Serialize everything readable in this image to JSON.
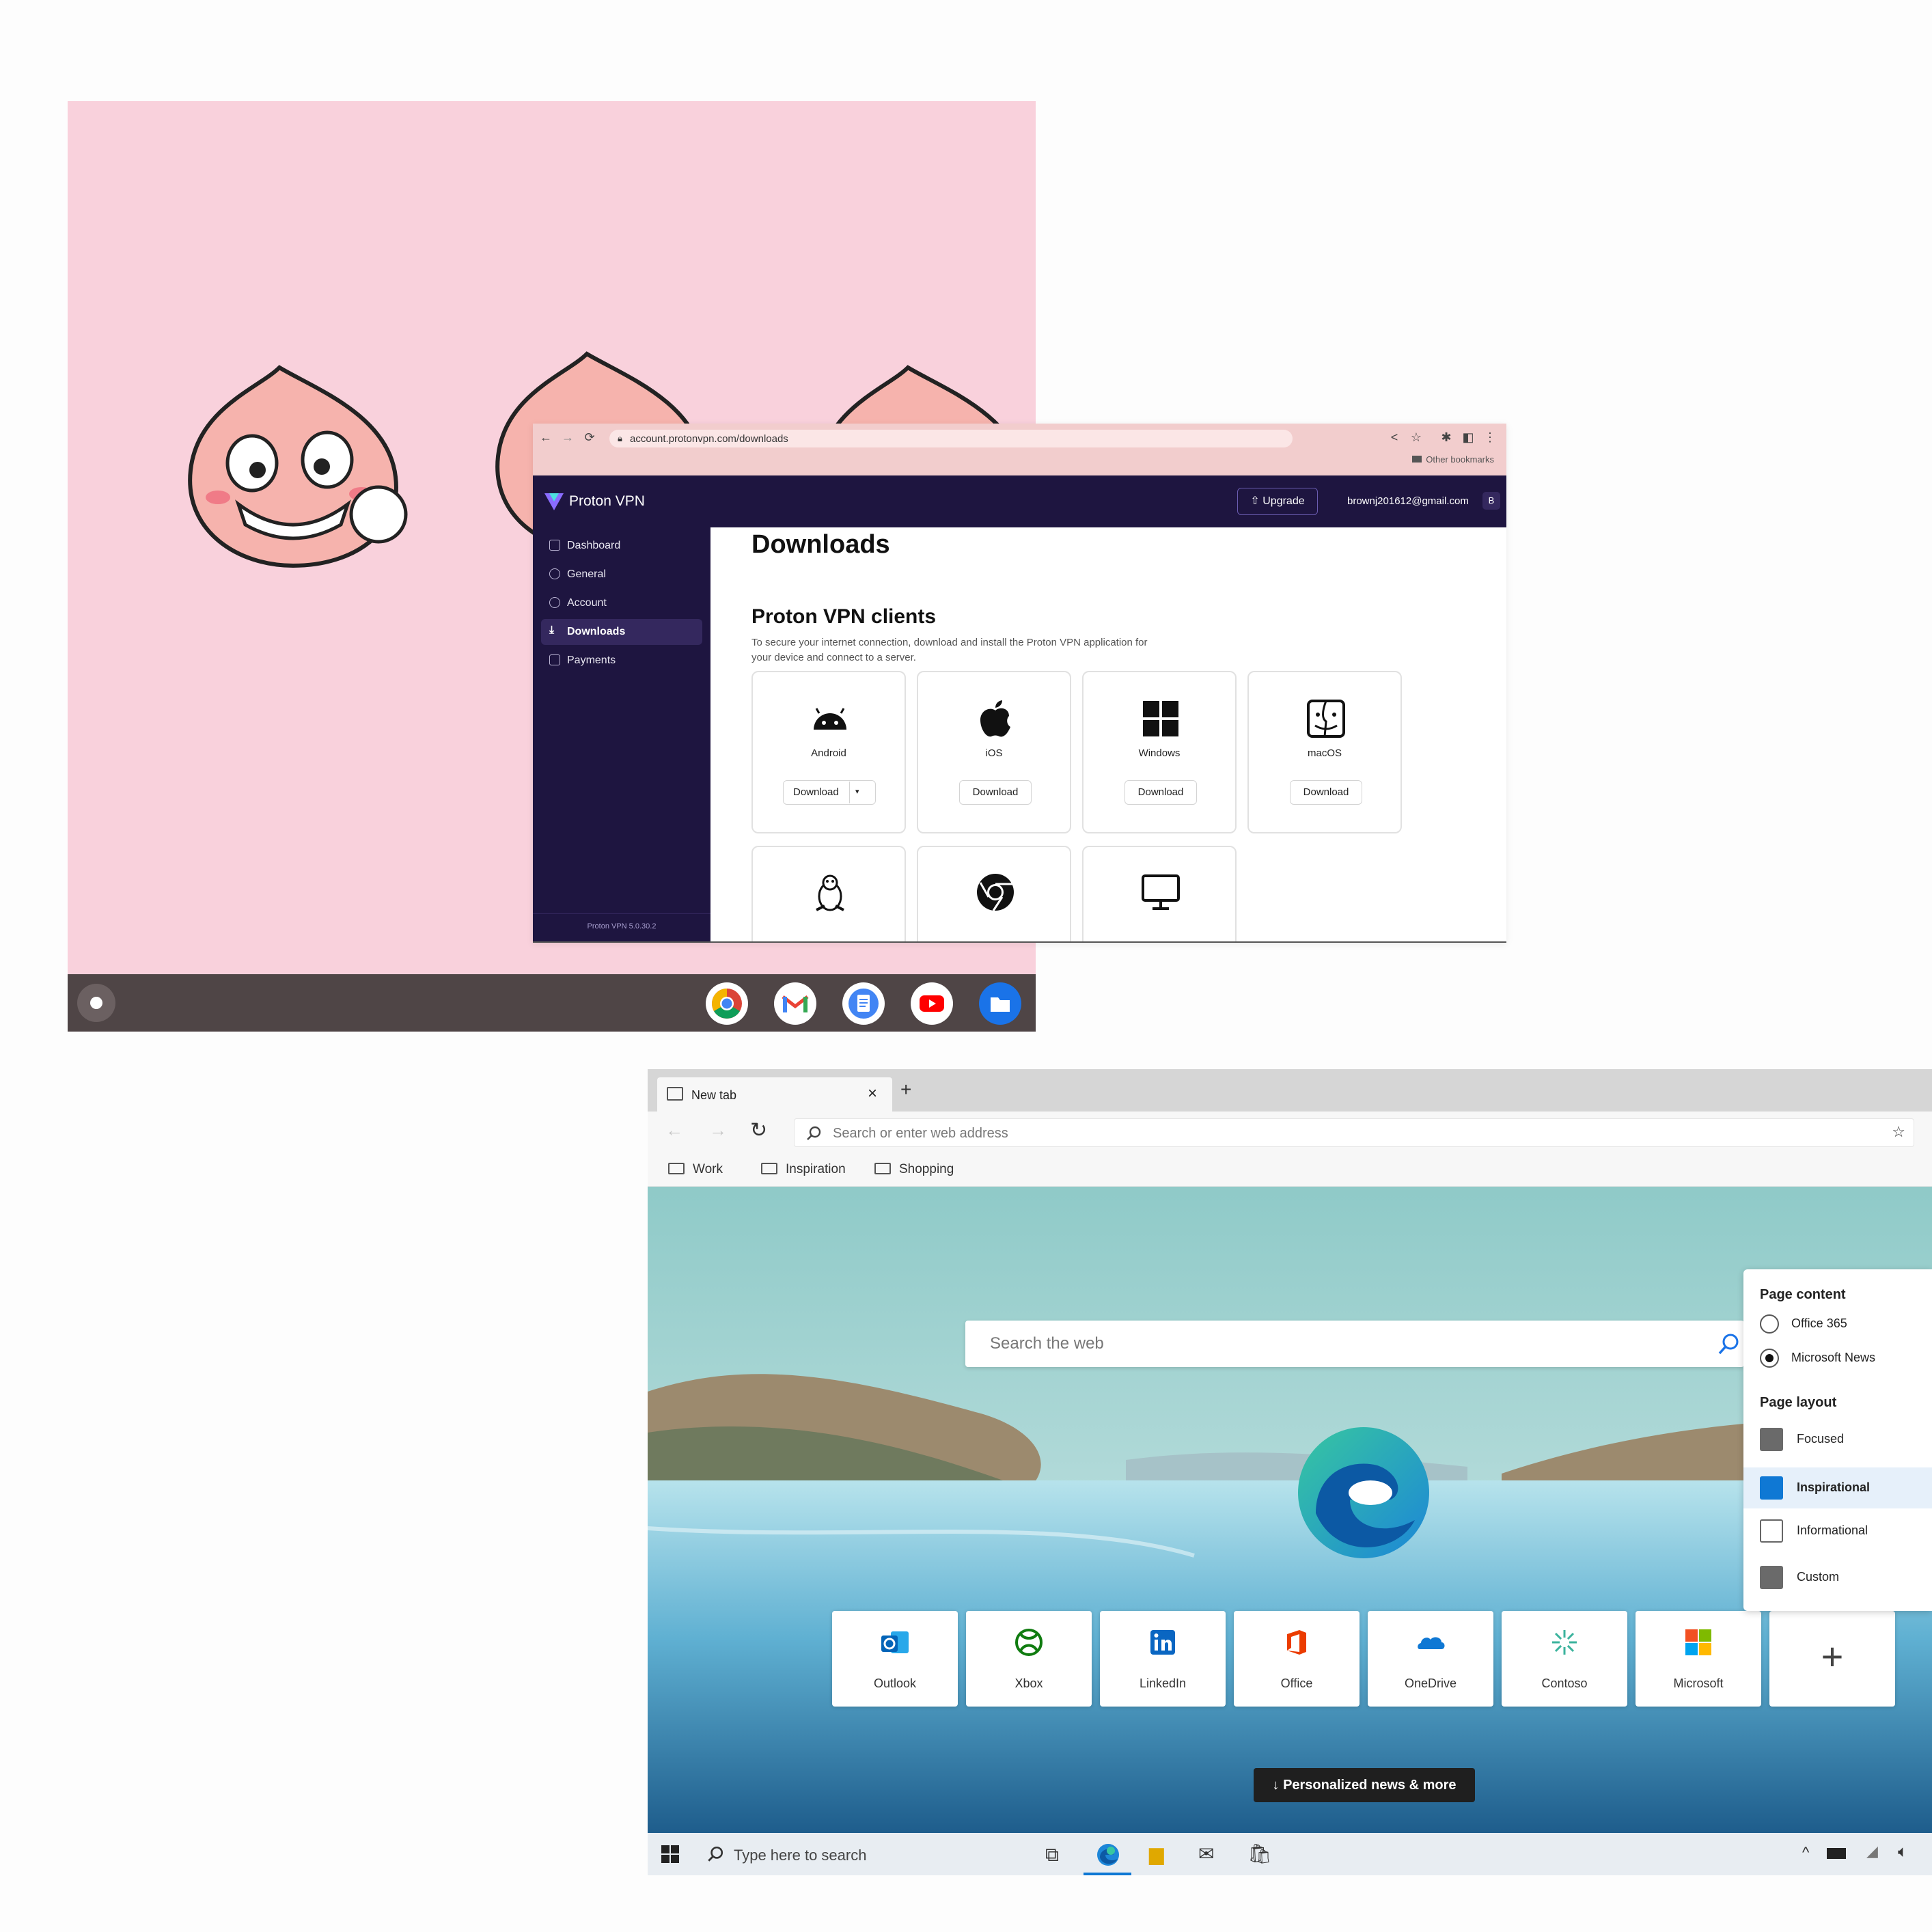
{
  "chromeos": {
    "shelf_apps": [
      "chrome-icon",
      "gmail-icon",
      "docs-icon",
      "youtube-icon",
      "files-icon"
    ]
  },
  "proton": {
    "url": "account.protonvpn.com/downloads",
    "bookmarks_label": "Other bookmarks",
    "brand": "Proton VPN",
    "upgrade_label": "Upgrade",
    "user_email": "brownj201612@gmail.com",
    "avatar_initial": "B",
    "nav": [
      {
        "label": "Dashboard",
        "icon": "dashboard-icon"
      },
      {
        "label": "General",
        "icon": "settings-icon"
      },
      {
        "label": "Account",
        "icon": "account-icon"
      },
      {
        "label": "Downloads",
        "icon": "download-icon"
      },
      {
        "label": "Payments",
        "icon": "payments-icon"
      }
    ],
    "active_nav": "Downloads",
    "version": "Proton VPN 5.0.30.2",
    "page_title": "Downloads",
    "section_title": "Proton VPN clients",
    "section_desc_line1": "To secure your internet connection, download and install the Proton VPN application for",
    "section_desc_line2": "your device and connect to a server.",
    "download_label": "Download",
    "clients": [
      {
        "name": "Android",
        "icon": "android-icon"
      },
      {
        "name": "iOS",
        "icon": "apple-icon"
      },
      {
        "name": "Windows",
        "icon": "windows-icon"
      },
      {
        "name": "macOS",
        "icon": "macos-finder-icon"
      }
    ],
    "clients_row2_icons": [
      "linux-icon",
      "chrome-icon",
      "monitor-icon"
    ]
  },
  "edge": {
    "tab_title": "New tab",
    "address_placeholder": "Search or enter web address",
    "favorites": [
      "Work",
      "Inspiration",
      "Shopping"
    ],
    "search_placeholder": "Search the web",
    "tiles": [
      "Outlook",
      "Xbox",
      "LinkedIn",
      "Office",
      "OneDrive",
      "Contoso",
      "Microsoft"
    ],
    "panel": {
      "content_heading": "Page content",
      "content_options": [
        "Office 365",
        "Microsoft News"
      ],
      "content_selected": "Microsoft News",
      "layout_heading": "Page layout",
      "layout_options": [
        "Focused",
        "Inspirational",
        "Informational",
        "Custom"
      ],
      "layout_selected": "Inspirational"
    },
    "news_button": "Personalized news & more",
    "taskbar_search": "Type here to search"
  }
}
